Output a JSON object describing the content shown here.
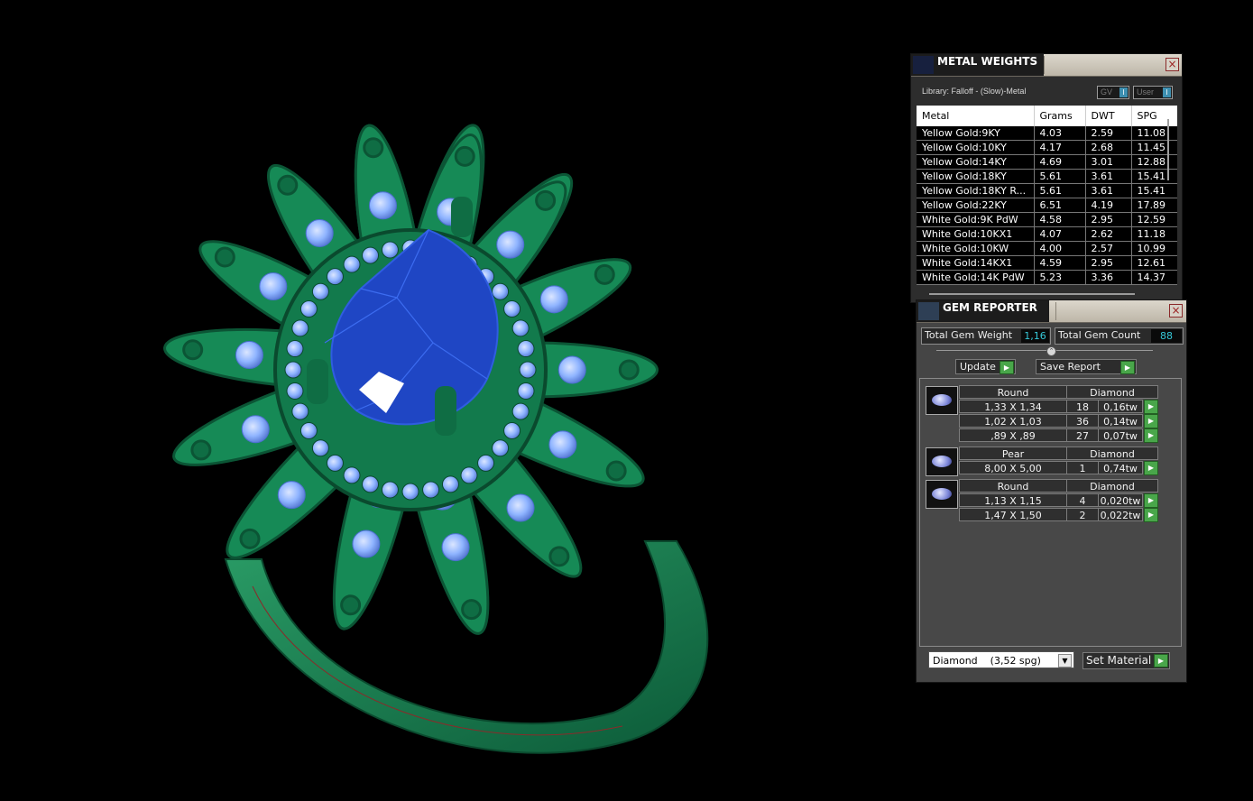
{
  "metal_weights": {
    "title": "METAL WEIGHTS",
    "library": "Library: Falloff - (Slow)-Metal",
    "toggle_gv": "GV",
    "toggle_user": "User",
    "headers": [
      "Metal",
      "Grams",
      "DWT",
      "SPG"
    ],
    "rows": [
      [
        "Yellow Gold:9KY",
        "4.03",
        "2.59",
        "11.08"
      ],
      [
        "Yellow Gold:10KY",
        "4.17",
        "2.68",
        "11.45"
      ],
      [
        "Yellow Gold:14KY",
        "4.69",
        "3.01",
        "12.88"
      ],
      [
        "Yellow Gold:18KY",
        "5.61",
        "3.61",
        "15.41"
      ],
      [
        "Yellow Gold:18KY R...",
        "5.61",
        "3.61",
        "15.41"
      ],
      [
        "Yellow Gold:22KY",
        "6.51",
        "4.19",
        "17.89"
      ],
      [
        "White Gold:9K PdW",
        "4.58",
        "2.95",
        "12.59"
      ],
      [
        "White Gold:10KX1",
        "4.07",
        "2.62",
        "11.18"
      ],
      [
        "White Gold:10KW",
        "4.00",
        "2.57",
        "10.99"
      ],
      [
        "White Gold:14KX1",
        "4.59",
        "2.95",
        "12.61"
      ],
      [
        "White Gold:14K PdW",
        "5.23",
        "3.36",
        "14.37"
      ]
    ]
  },
  "gem_reporter": {
    "title": "GEM REPORTER",
    "total_weight_label": "Total Gem Weight",
    "total_weight_value": "1,16",
    "total_count_label": "Total Gem Count",
    "total_count_value": "88",
    "update_label": "Update",
    "save_report_label": "Save Report",
    "groups": [
      {
        "shape": "Round",
        "material": "Diamond",
        "rows": [
          [
            "1,33 X 1,34",
            "18",
            "0,16tw"
          ],
          [
            "1,02 X 1,03",
            "36",
            "0,14tw"
          ],
          [
            ",89 X ,89",
            "27",
            "0,07tw"
          ]
        ]
      },
      {
        "shape": "Pear",
        "material": "Diamond",
        "rows": [
          [
            "8,00 X 5,00",
            "1",
            "0,74tw"
          ]
        ]
      },
      {
        "shape": "Round",
        "material": "Diamond",
        "rows": [
          [
            "1,13 X 1,15",
            "4",
            "0,020tw"
          ],
          [
            "1,47 X 1,50",
            "2",
            "0,022tw"
          ]
        ]
      }
    ],
    "material_select": "Diamond    (3,52 spg)",
    "set_material_label": "Set Material"
  },
  "colors": {
    "metal": "#1f8a57",
    "gem_accent": "#8fb4ff",
    "center_stone": "#1f46c4",
    "value_text": "#36c8d8",
    "play_button": "#49a64a"
  }
}
